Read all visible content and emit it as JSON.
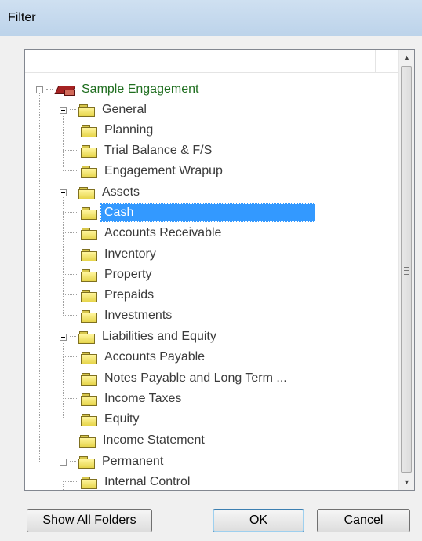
{
  "window": {
    "title": "Filter"
  },
  "tree": {
    "root": {
      "label": "Sample Engagement"
    },
    "groups": [
      {
        "label": "General",
        "children": [
          "Planning",
          "Trial Balance & F/S",
          "Engagement Wrapup"
        ]
      },
      {
        "label": "Assets",
        "children": [
          "Cash",
          "Accounts Receivable",
          "Inventory",
          "Property",
          "Prepaids",
          "Investments"
        ]
      },
      {
        "label": "Liabilities and Equity",
        "children": [
          "Accounts Payable",
          "Notes Payable and Long Term ...",
          "Income Taxes",
          "Equity"
        ]
      },
      {
        "label": "Income Statement",
        "children": []
      },
      {
        "label": "Permanent",
        "children": [
          "Internal Control"
        ]
      }
    ],
    "selected": "Cash"
  },
  "buttons": {
    "show_all_folders_first": "S",
    "show_all_folders_rest": "how All Folders",
    "ok": "OK",
    "cancel": "Cancel"
  },
  "colors": {
    "selection": "#3399ff",
    "root_label": "#1f6e1f",
    "folder": "#f5e66a"
  }
}
